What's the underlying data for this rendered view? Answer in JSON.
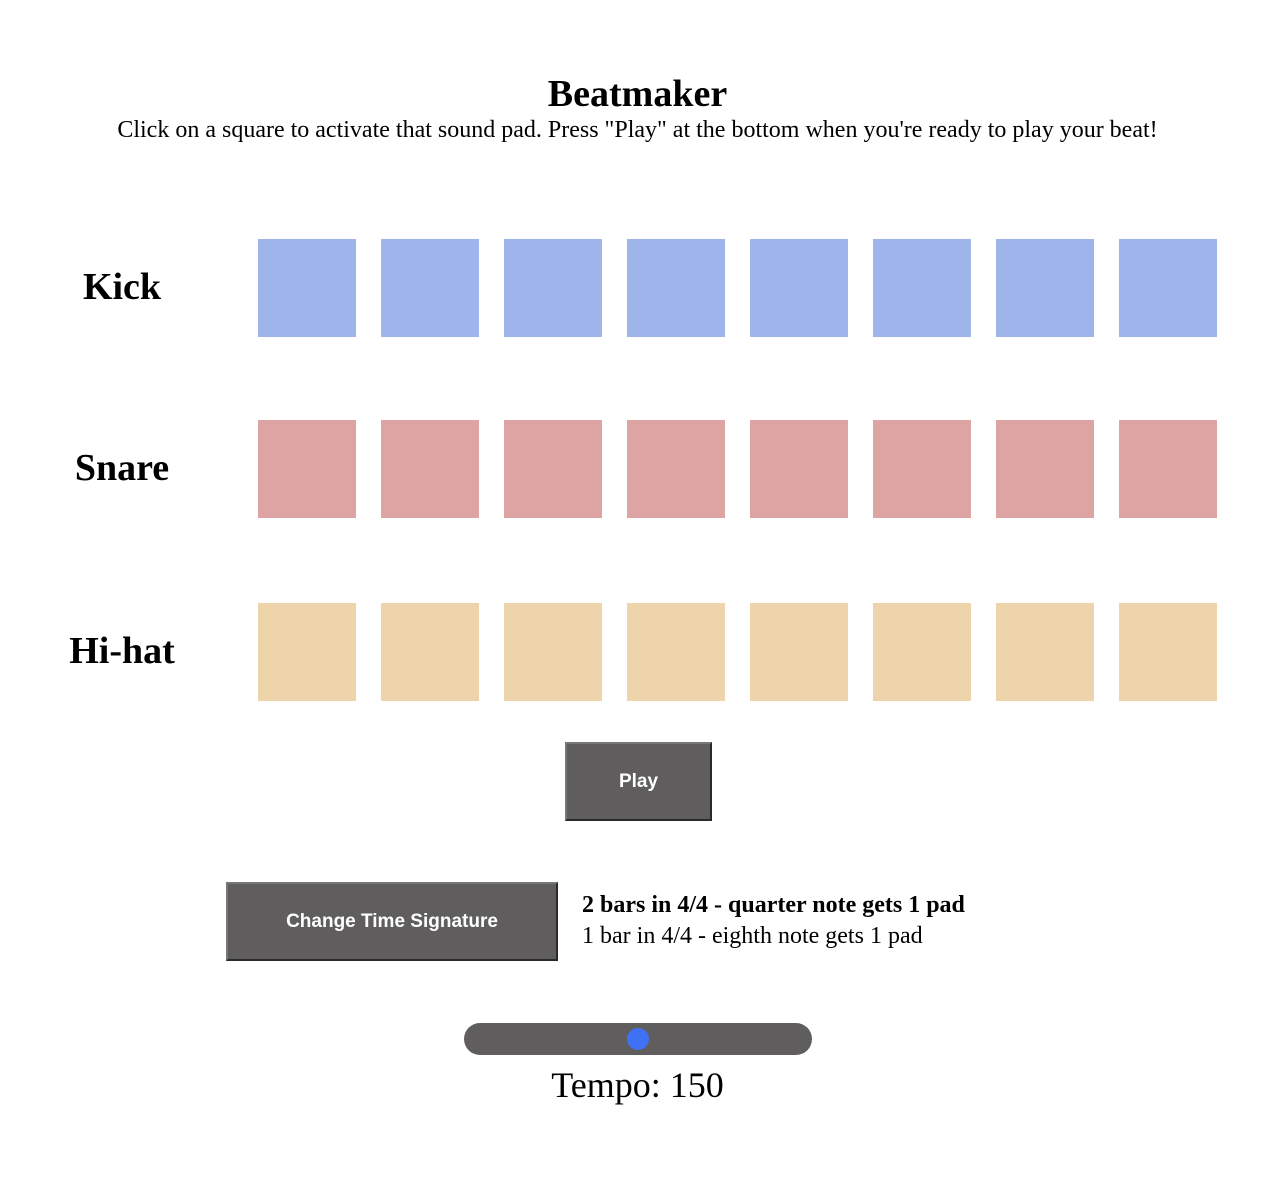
{
  "header": {
    "title": "Beatmaker",
    "subtitle": "Click on a square to activate that sound pad. Press \"Play\" at the bottom when you're ready to play your beat!"
  },
  "rows": [
    {
      "label": "Kick",
      "color": "#9fb4ea",
      "pads": 8
    },
    {
      "label": "Snare",
      "color": "#dea4a4",
      "pads": 8
    },
    {
      "label": "Hi-hat",
      "color": "#edd4ab",
      "pads": 8
    }
  ],
  "controls": {
    "play_label": "Play",
    "time_signature_label": "Change Time Signature",
    "time_signature_options": [
      {
        "text": "2 bars in 4/4 - quarter note gets 1 pad",
        "selected": true
      },
      {
        "text": "1 bar in 4/4 - eighth note gets 1 pad",
        "selected": false
      }
    ],
    "tempo_label": "Tempo: 150",
    "tempo_value": 150,
    "tempo_fill_fraction": 0.5,
    "thumb_color": "#4070f4",
    "button_color": "#5f5d5e"
  }
}
